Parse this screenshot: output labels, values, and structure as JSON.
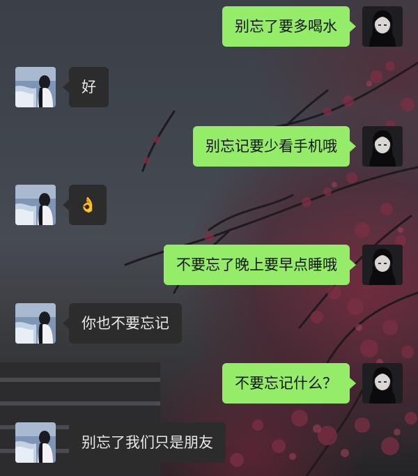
{
  "chat": {
    "messages": [
      {
        "sender": "me",
        "text": "别忘了要多喝水"
      },
      {
        "sender": "them",
        "text": "好"
      },
      {
        "sender": "me",
        "text": "别忘记要少看手机哦"
      },
      {
        "sender": "them",
        "text": "👌"
      },
      {
        "sender": "me",
        "text": "不要忘了晚上要早点睡哦"
      },
      {
        "sender": "them",
        "text": "你也不要忘记"
      },
      {
        "sender": "me",
        "text": "不要忘记什么？"
      },
      {
        "sender": "them",
        "text": "别忘了我们只是朋友"
      }
    ]
  },
  "colors": {
    "my_bubble": "#95ec69",
    "their_bubble": "#2c2c2c",
    "my_text": "#111111",
    "their_text": "#e9e9e9"
  }
}
